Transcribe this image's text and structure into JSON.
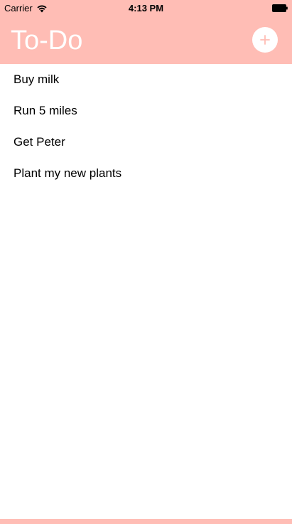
{
  "status_bar": {
    "carrier": "Carrier",
    "time": "4:13 PM",
    "wifi_icon": "wifi-icon",
    "battery_icon": "battery-icon"
  },
  "nav": {
    "title": "To-Do",
    "add_icon": "plus-icon"
  },
  "todos": [
    {
      "label": "Buy milk"
    },
    {
      "label": "Run 5 miles"
    },
    {
      "label": "Get Peter"
    },
    {
      "label": "Plant my new plants"
    }
  ],
  "colors": {
    "accent": "#ffbdb5",
    "background": "#ffffff",
    "text": "#000000"
  }
}
